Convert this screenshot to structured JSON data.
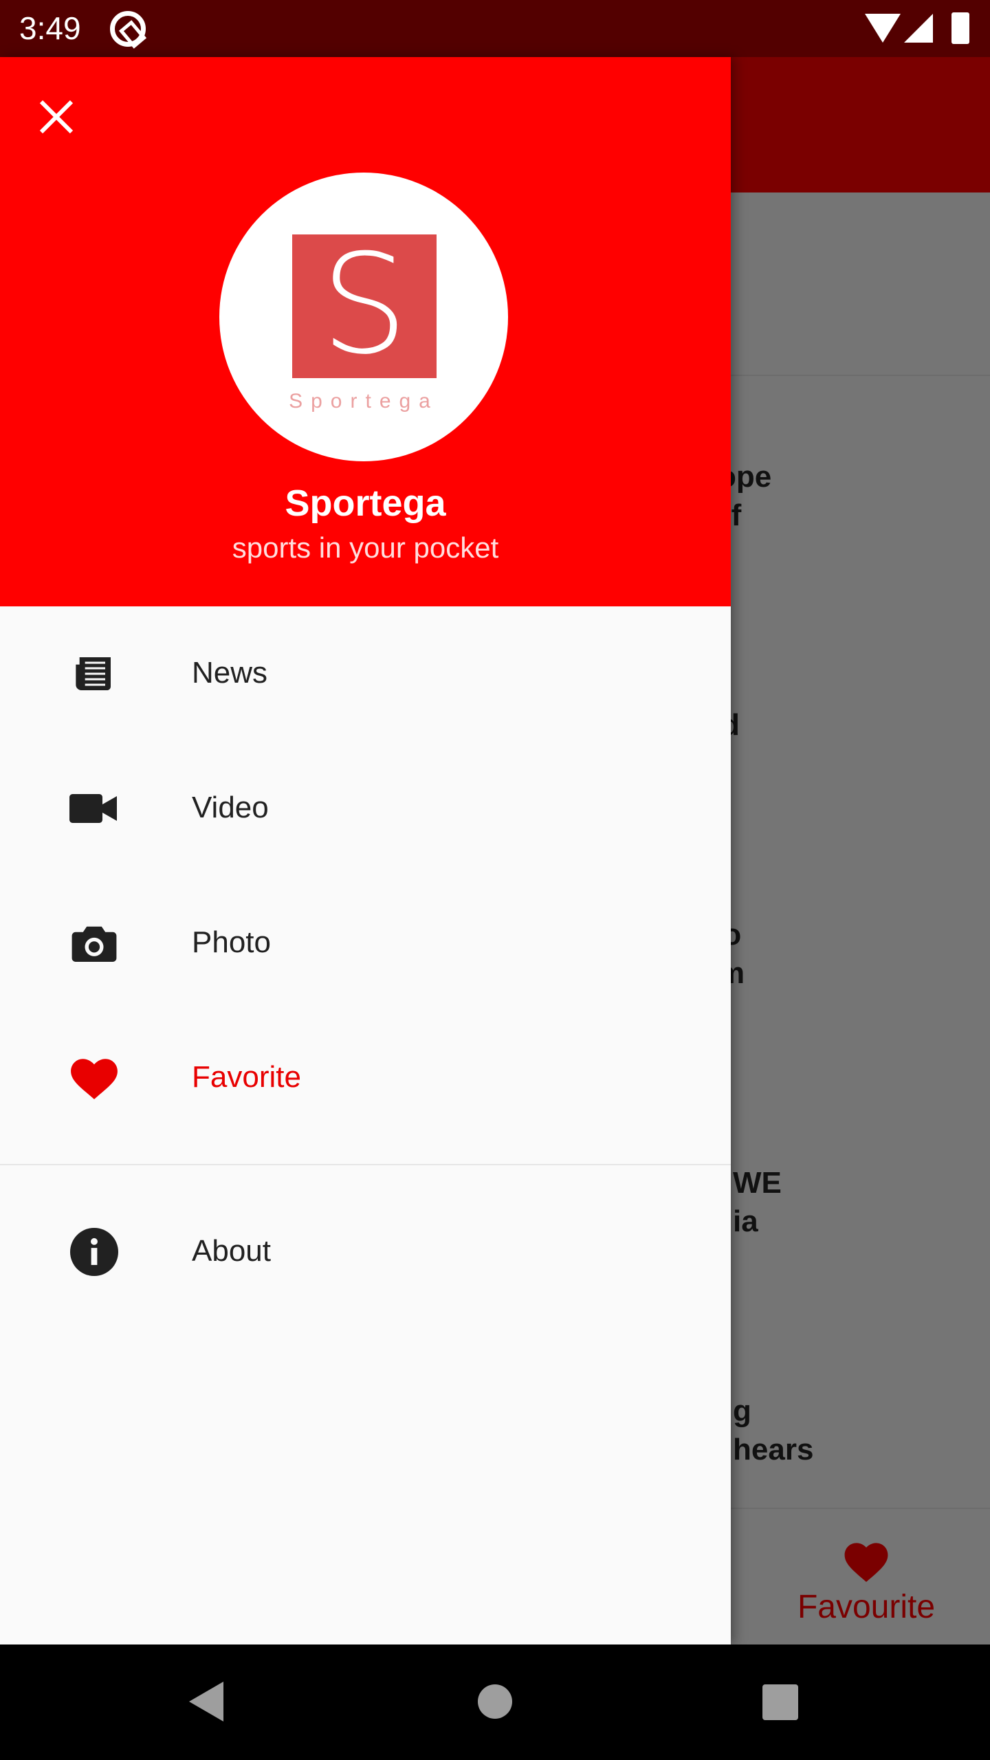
{
  "status_bar": {
    "time": "3:49"
  },
  "drawer": {
    "header": {
      "logo_text": "Sportega",
      "logo_letter": "S",
      "title": "Sportega",
      "subtitle": "sports in your pocket",
      "color": "#ff0000"
    },
    "items": [
      {
        "label": "News",
        "icon": "newspaper-icon"
      },
      {
        "label": "Video",
        "icon": "videocam-icon"
      },
      {
        "label": "Photo",
        "icon": "camera-icon"
      },
      {
        "label": "Favorite",
        "icon": "heart-icon",
        "active": true
      },
      {
        "label": "About",
        "icon": "info-icon"
      }
    ],
    "active_color": "#e80000"
  },
  "background": {
    "fragments": [
      "urope\ne of",
      "ead\nrs",
      "ano\nrom",
      "WE\nia",
      "g\nhears"
    ],
    "bottom_nav": {
      "favourite_label": "Favourite"
    }
  }
}
